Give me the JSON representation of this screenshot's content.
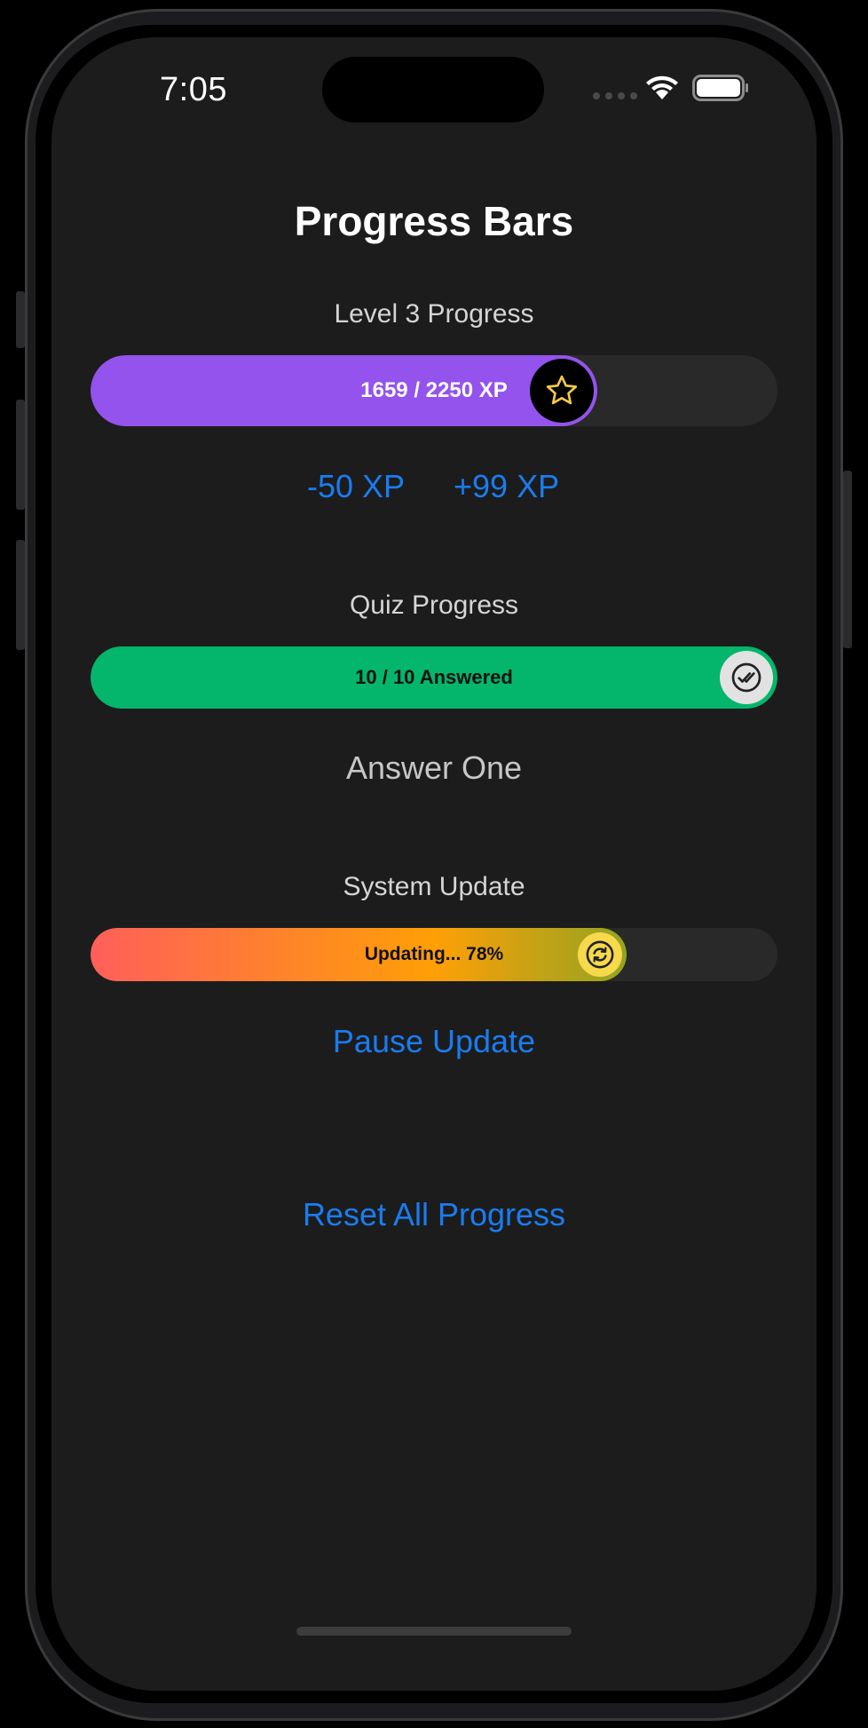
{
  "status_bar": {
    "time": "7:05"
  },
  "page": {
    "title": "Progress Bars"
  },
  "level": {
    "label": "Level 3 Progress",
    "progress_text": "1659 / 2250 XP",
    "current": 1659,
    "total": 2250,
    "fill_color": "#9353ec",
    "icon": "star-icon",
    "minus_button": "-50 XP",
    "plus_button": "+99 XP"
  },
  "quiz": {
    "label": "Quiz Progress",
    "progress_text": "10 / 10 Answered",
    "answered": 10,
    "total": 10,
    "fill_color": "#03b66c",
    "icon": "double-check-icon",
    "answer_button": "Answer One"
  },
  "update": {
    "label": "System Update",
    "progress_text": "Updating... 78%",
    "percent": 78,
    "gradient": [
      "#ff5f5a",
      "#ff9f06",
      "#3ea838"
    ],
    "icon": "refresh-icon",
    "pause_button": "Pause Update"
  },
  "reset_button": "Reset All Progress"
}
